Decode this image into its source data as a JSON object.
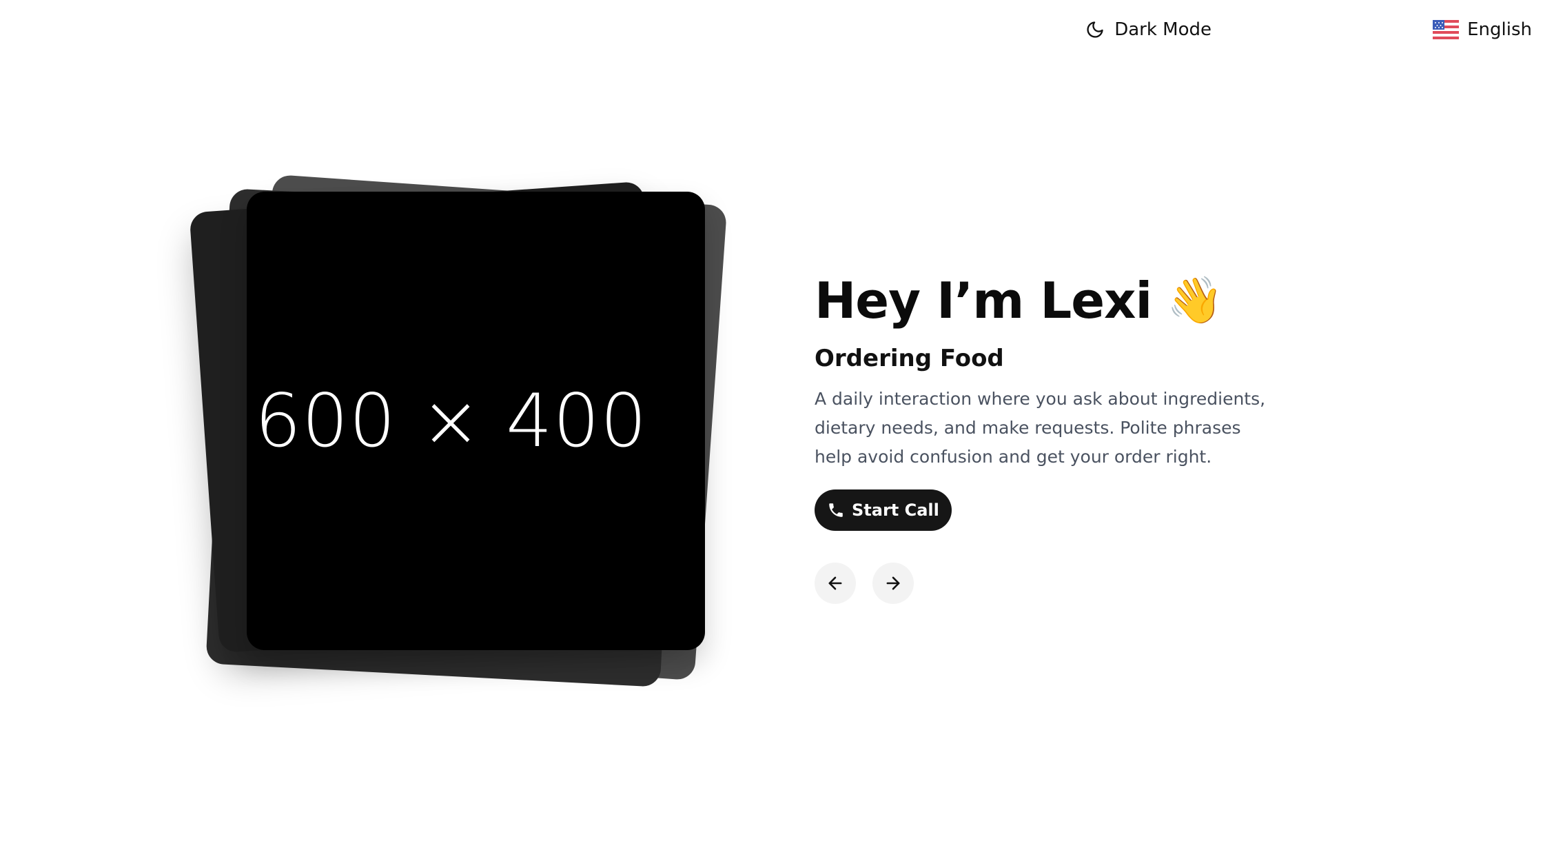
{
  "topbar": {
    "dark_mode_label": "Dark Mode",
    "language_label": "English",
    "dark_mode_icon": "moon-icon",
    "language_icon": "us-flag-icon"
  },
  "card": {
    "placeholder_text": "600 × 400"
  },
  "hero": {
    "title": "Hey I’m Lexi",
    "emoji": "👋",
    "subtitle": "Ordering Food",
    "description": "A daily interaction where you ask about ingredients, dietary needs, and make requests. Polite phrases help avoid confusion and get your order right.",
    "call_button_label": "Start Call",
    "call_icon": "phone-icon"
  },
  "nav": {
    "prev_icon": "arrow-left-icon",
    "next_icon": "arrow-right-icon"
  },
  "colors": {
    "background": "#ffffff",
    "text": "#0b0b0b",
    "muted_text": "#4a5260",
    "button_dark": "#161616",
    "nav_button_bg": "#f3f3f3"
  }
}
